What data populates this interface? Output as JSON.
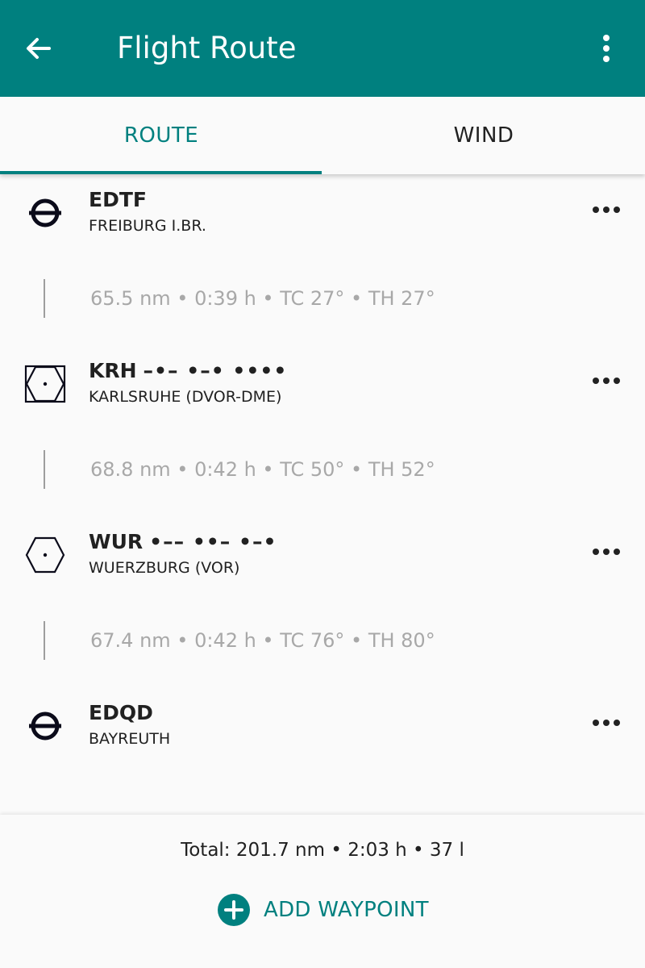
{
  "appbar": {
    "title": "Flight Route",
    "back_icon": "arrow-left-icon",
    "menu_icon": "more-vertical-icon",
    "background_color": "#00807f"
  },
  "tabs": [
    {
      "label": "ROUTE",
      "selected": true
    },
    {
      "label": "WIND",
      "selected": false
    }
  ],
  "waypoints": [
    {
      "ident": "EDTF",
      "morse": "",
      "name": "FREIBURG I.BR.",
      "icon": "airport-icon"
    },
    {
      "ident": "KRH",
      "morse": "–•– •–• ••••",
      "name": "KARLSRUHE (DVOR-DME)",
      "icon": "dvor-dme-icon"
    },
    {
      "ident": "WUR",
      "morse": "•–– ••– •–•",
      "name": "WUERZBURG (VOR)",
      "icon": "vor-icon"
    },
    {
      "ident": "EDQD",
      "morse": "",
      "name": "BAYREUTH",
      "icon": "airport-icon"
    }
  ],
  "legs": [
    {
      "text": "65.5 nm • 0:39 h • TC 27° • TH 27°"
    },
    {
      "text": "68.8 nm • 0:42 h • TC 50° • TH 52°"
    },
    {
      "text": "67.4 nm • 0:42 h • TC 76° • TH 80°"
    }
  ],
  "footer": {
    "total": "Total: 201.7 nm • 2:03 h • 37 l",
    "add_label": "ADD WAYPOINT",
    "add_icon": "plus-circle-icon"
  },
  "colors": {
    "accent": "#00807f",
    "secondary_text": "#a8a8a8"
  }
}
